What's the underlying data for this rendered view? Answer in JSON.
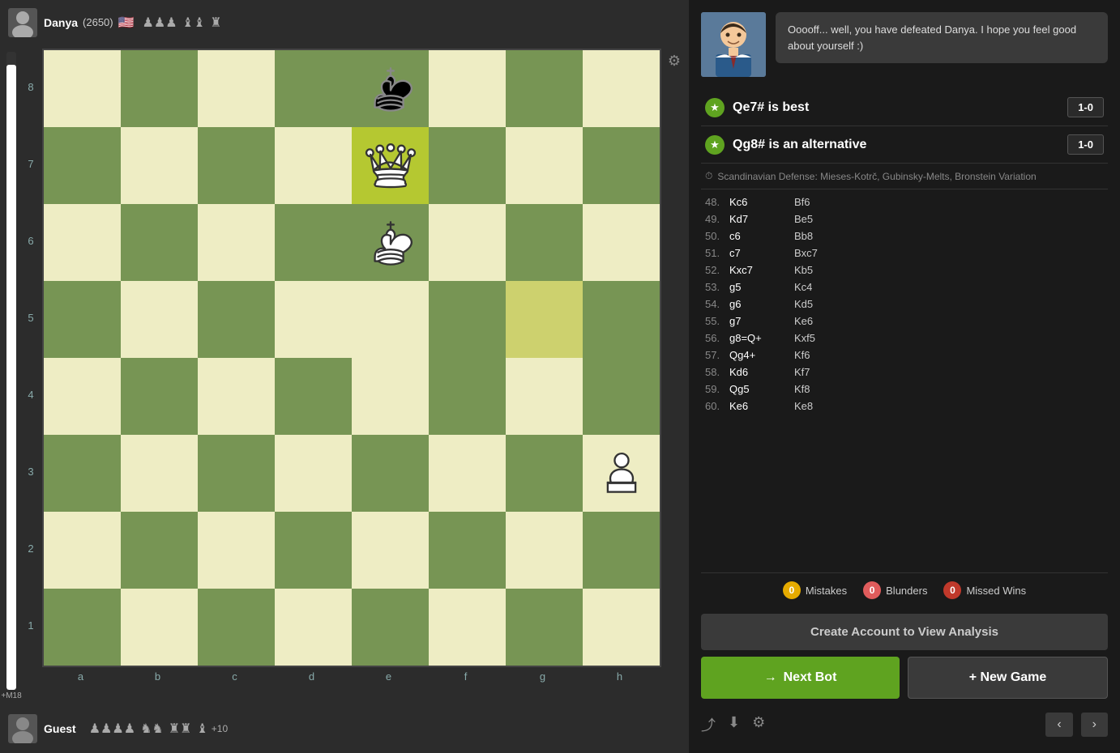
{
  "players": {
    "top": {
      "name": "Danya",
      "rating": "(2650)",
      "flag": "🇺🇸",
      "captured": "♟♟♟  ♝♝ ♜"
    },
    "bottom": {
      "name": "Guest",
      "captured": "♟♟♟♟ ♞♞ ♜♜ ♝",
      "extra": "+10"
    }
  },
  "eval": {
    "label": "+M18",
    "fill_percent": 98
  },
  "settings_icon": "⚙",
  "bot_message": {
    "speech": "Ooooff... well, you have defeated Danya. I hope you feel good about yourself :)"
  },
  "best_moves": [
    {
      "move": "Qe7# is best",
      "result": "1-0"
    },
    {
      "move": "Qg8# is an alternative",
      "result": "1-0"
    }
  ],
  "opening": "Scandinavian Defense: Mieses-Kotrč, Gubinsky-Melts, Bronstein Variation",
  "moves": [
    {
      "num": "48.",
      "white": "Kc6",
      "black": "Bf6"
    },
    {
      "num": "49.",
      "white": "Kd7",
      "black": "Be5"
    },
    {
      "num": "50.",
      "white": "c6",
      "black": "Bb8"
    },
    {
      "num": "51.",
      "white": "c7",
      "black": "Bxc7"
    },
    {
      "num": "52.",
      "white": "Kxc7",
      "black": "Kb5"
    },
    {
      "num": "53.",
      "white": "g5",
      "black": "Kc4"
    },
    {
      "num": "54.",
      "white": "g6",
      "black": "Kd5"
    },
    {
      "num": "55.",
      "white": "g7",
      "black": "Ke6"
    },
    {
      "num": "56.",
      "white": "g8=Q+",
      "black": "Kxf5"
    },
    {
      "num": "57.",
      "white": "Qg4+",
      "black": "Kf6"
    },
    {
      "num": "58.",
      "white": "Kd6",
      "black": "Kf7"
    },
    {
      "num": "59.",
      "white": "Qg5",
      "black": "Kf8"
    },
    {
      "num": "60.",
      "white": "Ke6",
      "black": "Ke8"
    }
  ],
  "stats": {
    "mistakes": {
      "count": "0",
      "label": "Mistakes"
    },
    "blunders": {
      "count": "0",
      "label": "Blunders"
    },
    "missed_wins": {
      "count": "0",
      "label": "Missed Wins"
    }
  },
  "buttons": {
    "analysis": "Create Account to View Analysis",
    "next_bot": "Next Bot",
    "new_game": "+ New Game"
  },
  "toolbar": {
    "share": "share",
    "download": "download",
    "settings": "settings",
    "prev": "‹",
    "next": "›"
  },
  "board": {
    "ranks": [
      "8",
      "7",
      "6",
      "5",
      "4",
      "3",
      "2",
      "1"
    ],
    "files": [
      "a",
      "b",
      "c",
      "d",
      "e",
      "f",
      "g",
      "h"
    ],
    "highlight_squares": [
      "e5",
      "g5"
    ]
  }
}
